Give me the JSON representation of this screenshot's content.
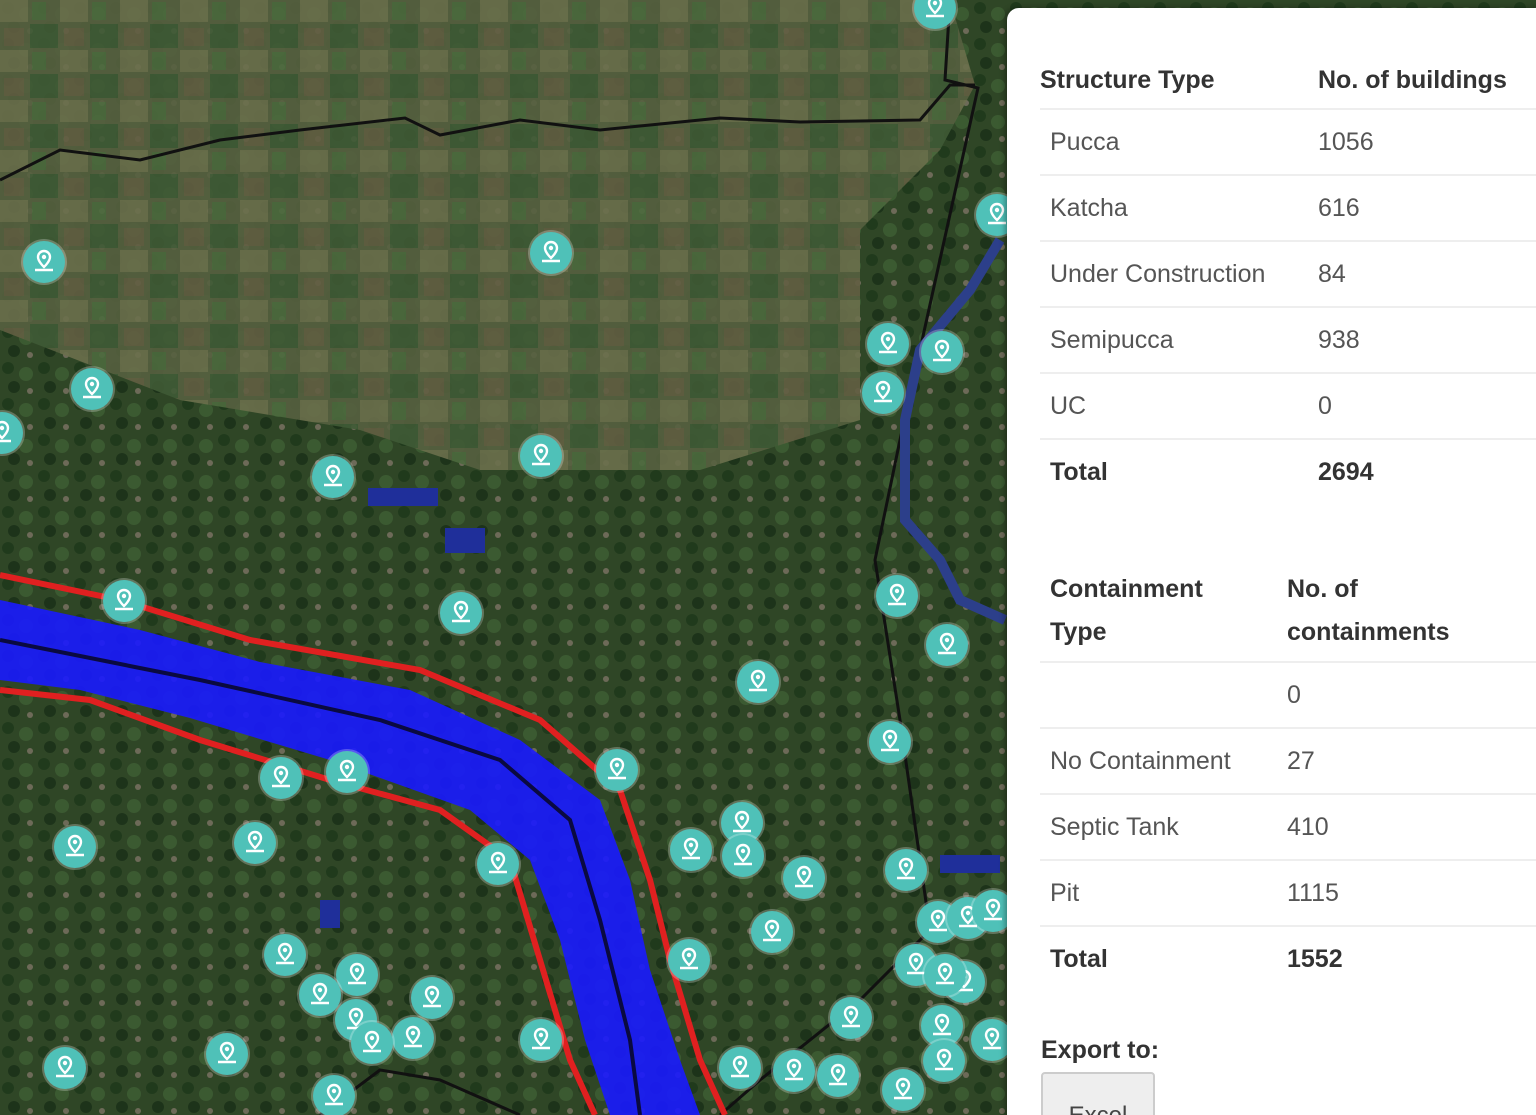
{
  "map": {
    "markers": "map-marker-icon"
  },
  "structure_table": {
    "headers": [
      "Structure Type",
      "No. of buildings"
    ],
    "rows": [
      {
        "type": "Pucca",
        "count": "1056"
      },
      {
        "type": "Katcha",
        "count": "616"
      },
      {
        "type": "Under Construction",
        "count": "84"
      },
      {
        "type": "Semipucca",
        "count": "938"
      },
      {
        "type": "UC",
        "count": "0"
      }
    ],
    "total": {
      "label": "Total",
      "count": "2694"
    }
  },
  "containment_table": {
    "headers": [
      "Containment Type",
      "No. of containments"
    ],
    "rows": [
      {
        "type": "",
        "count": "0"
      },
      {
        "type": "No Containment",
        "count": "27"
      },
      {
        "type": "Septic Tank",
        "count": "410"
      },
      {
        "type": "Pit",
        "count": "1115"
      }
    ],
    "total": {
      "label": "Total",
      "count": "1552"
    }
  },
  "export": {
    "label": "Export to:",
    "excel_button": "Excel"
  },
  "colors": {
    "marker": "#4fc1b8",
    "river_fill": "#1a1aff",
    "buffer_outline": "#e02020",
    "boundary": "#111111"
  }
}
